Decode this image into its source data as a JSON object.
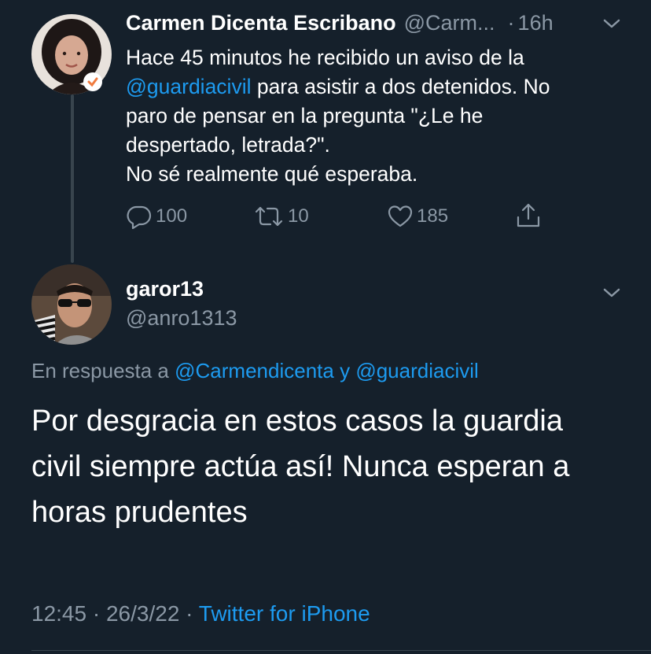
{
  "parent_tweet": {
    "author_name": "Carmen Dicenta Escribano",
    "handle_truncated": "@Carm...",
    "time_separator": "·",
    "time": "16h",
    "text": {
      "line1": "Hace 45 minutos he recibido un aviso de la",
      "mention": "@guardiacivil",
      "line2_rest": " para asistir a dos detenidos. No",
      "line3": "paro de pensar en la pregunta \"¿Le he",
      "line4": "despertado, letrada?\".",
      "line5": "No sé realmente qué esperaba."
    },
    "actions": {
      "replies": "100",
      "retweets": "10",
      "likes": "185"
    }
  },
  "reply_tweet": {
    "author_name": "garor13",
    "handle": "@anro1313",
    "replying_to_prefix": "En respuesta a",
    "replying_to_user1": "@Carmendicenta",
    "replying_to_conj": "y",
    "replying_to_user2": "@guardiacivil",
    "body": {
      "line1": "Por desgracia en estos casos la guardia",
      "line2": "civil siempre actúa así! Nunca esperan a",
      "line3": "horas prudentes"
    },
    "footer": {
      "time": "12:45",
      "sep1": "·",
      "date": "26/3/22",
      "sep2": "·",
      "source": "Twitter for iPhone"
    }
  },
  "colors": {
    "background": "#15202b",
    "text": "#ffffff",
    "muted": "#8b98a5",
    "link": "#1d9bf0",
    "divider": "#38444d"
  }
}
